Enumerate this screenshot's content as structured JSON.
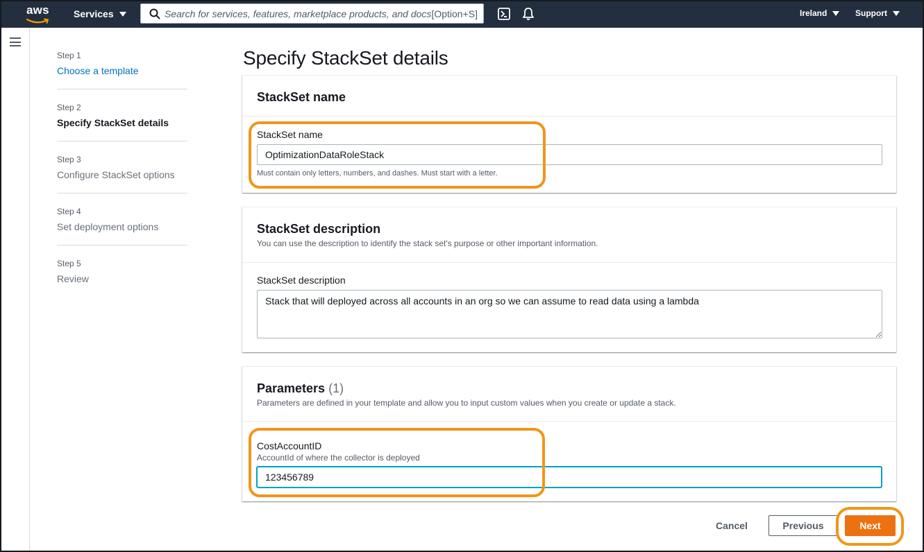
{
  "nav": {
    "logo": "aws",
    "services_label": "Services",
    "search_placeholder": "Search for services, features, marketplace products, and docs",
    "search_shortcut": "[Option+S]",
    "region_label": "Ireland",
    "support_label": "Support"
  },
  "wizard": {
    "steps": [
      {
        "num": "Step 1",
        "title": "Choose a template",
        "state": "link"
      },
      {
        "num": "Step 2",
        "title": "Specify StackSet details",
        "state": "current"
      },
      {
        "num": "Step 3",
        "title": "Configure StackSet options",
        "state": "disabled"
      },
      {
        "num": "Step 4",
        "title": "Set deployment options",
        "state": "disabled"
      },
      {
        "num": "Step 5",
        "title": "Review",
        "state": "disabled"
      }
    ]
  },
  "page": {
    "title": "Specify StackSet details"
  },
  "name_panel": {
    "header": "StackSet name",
    "field_label": "StackSet name",
    "value": "OptimizationDataRoleStack",
    "hint": "Must contain only letters, numbers, and dashes. Must start with a letter."
  },
  "description_panel": {
    "header": "StackSet description",
    "header_desc": "You can use the description to identify the stack set's purpose or other important information.",
    "field_label": "StackSet description",
    "value": "Stack that will deployed across all accounts in an org so we can assume to read data using a lambda"
  },
  "parameters_panel": {
    "header": "Parameters",
    "count": "(1)",
    "header_desc": "Parameters are defined in your template and allow you to input custom values when you create or update a stack.",
    "field_label": "CostAccountID",
    "field_desc": "AccountId of where the collector is deployed",
    "value": "123456789"
  },
  "footer": {
    "cancel_label": "Cancel",
    "previous_label": "Previous",
    "next_label": "Next"
  },
  "colors": {
    "nav_bg": "#232f3e",
    "primary": "#ec7211",
    "link": "#0073bb",
    "highlight": "#f0961b",
    "focus": "#00a1c9"
  }
}
